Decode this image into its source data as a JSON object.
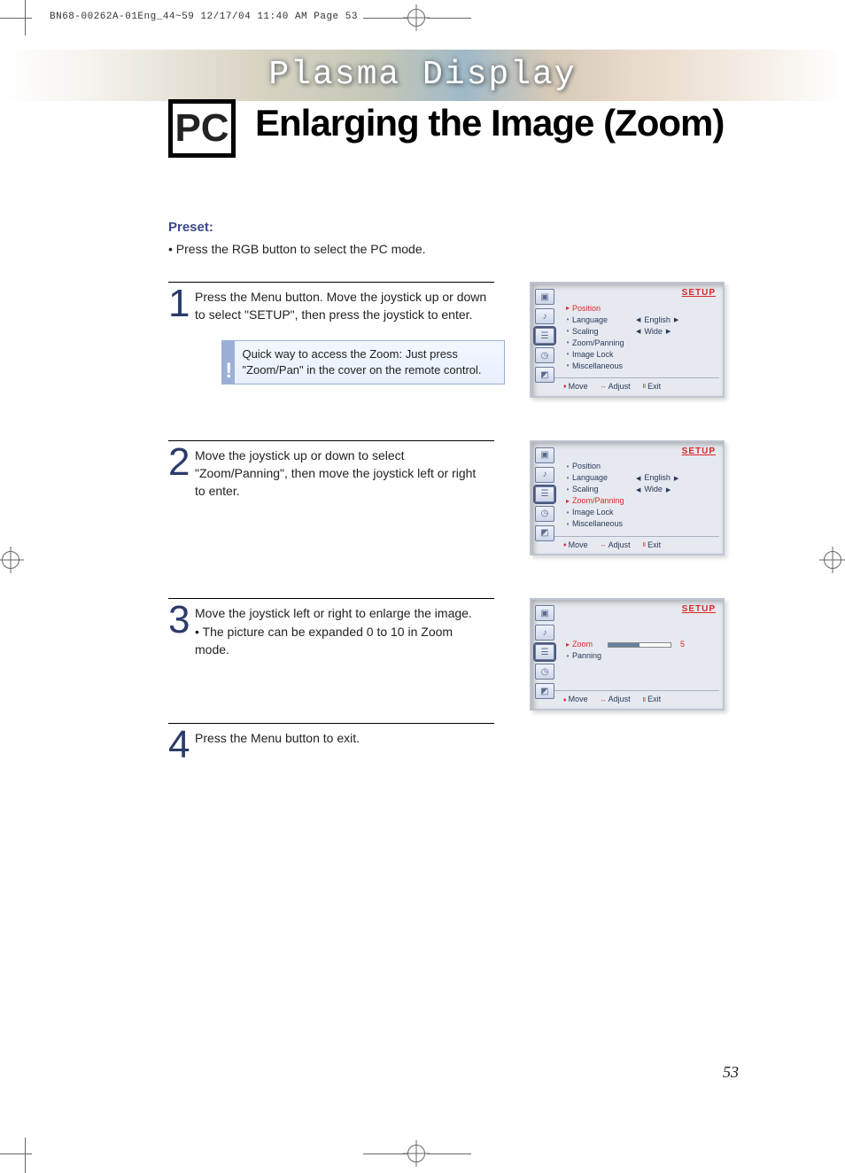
{
  "meta_header": "BN68-00262A-01Eng_44~59  12/17/04  11:40 AM  Page 53",
  "banner_title": "Plasma Display",
  "pc_badge": "PC",
  "page_title": "Enlarging the Image (Zoom)",
  "preset": {
    "heading": "Preset:",
    "body": "Press the RGB button to select the PC mode."
  },
  "steps": [
    {
      "num": "1",
      "text": "Press the Menu button. Move the joystick up or down to select  \"SETUP\", then press the joystick to enter.",
      "callout": "Quick way to access the Zoom: Just press \"Zoom/Pan\" in the cover on the remote control."
    },
    {
      "num": "2",
      "text": "Move the joystick up or down to select \"Zoom/Panning\", then move the joystick left or right  to enter."
    },
    {
      "num": "3",
      "text": "Move the joystick left or right to enlarge the image.\n• The picture can be expanded 0 to 10 in Zoom mode."
    },
    {
      "num": "4",
      "text": "Press the Menu button to exit."
    }
  ],
  "osd": {
    "title": "SETUP",
    "labels": {
      "position": "Position",
      "language": "Language",
      "scaling": "Scaling",
      "zoompan": "Zoom/Panning",
      "imagelock": "Image Lock",
      "misc": "Miscellaneous",
      "zoom": "Zoom",
      "panning": "Panning"
    },
    "values": {
      "english": "English",
      "wide": "Wide",
      "zoom_val": "5"
    },
    "footer": {
      "move": "Move",
      "adjust": "Adjust",
      "exit": "Exit"
    }
  },
  "page_number": "53"
}
